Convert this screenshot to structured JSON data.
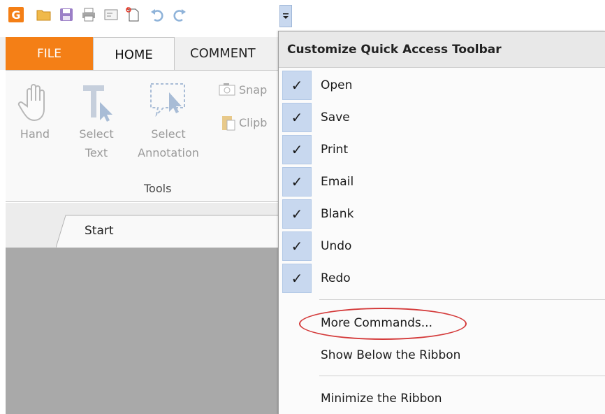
{
  "toolbar": {
    "icons": [
      "app-logo-icon",
      "open-folder-icon",
      "save-icon",
      "print-icon",
      "email-icon",
      "blank-icon",
      "undo-icon",
      "redo-icon",
      "customize-dropdown-icon"
    ]
  },
  "tabs": {
    "file": "FILE",
    "home": "HOME",
    "comment": "COMMENT"
  },
  "ribbon": {
    "hand": "Hand",
    "select_text_1": "Select",
    "select_text_2": "Text",
    "select_annotation_1": "Select",
    "select_annotation_2": "Annotation",
    "snapshot": "Snap",
    "clipboard": "Clipb",
    "group_label": "Tools"
  },
  "document": {
    "tab_start": "Start"
  },
  "menu": {
    "title": "Customize Quick Access Toolbar",
    "items": [
      {
        "label": "Open",
        "checked": "✓"
      },
      {
        "label": "Save",
        "checked": "✓"
      },
      {
        "label": "Print",
        "checked": "✓"
      },
      {
        "label": "Email",
        "checked": "✓"
      },
      {
        "label": "Blank",
        "checked": "✓"
      },
      {
        "label": "Undo",
        "checked": "✓"
      },
      {
        "label": "Redo",
        "checked": "✓"
      }
    ],
    "more_commands": "More Commands...",
    "show_below": "Show Below the Ribbon",
    "minimize": "Minimize the Ribbon"
  },
  "colors": {
    "file_tab": "#f47f16",
    "check_bg": "#c8d8ef",
    "highlight_oval": "#d43a3a",
    "workspace": "#a9a9a9"
  }
}
